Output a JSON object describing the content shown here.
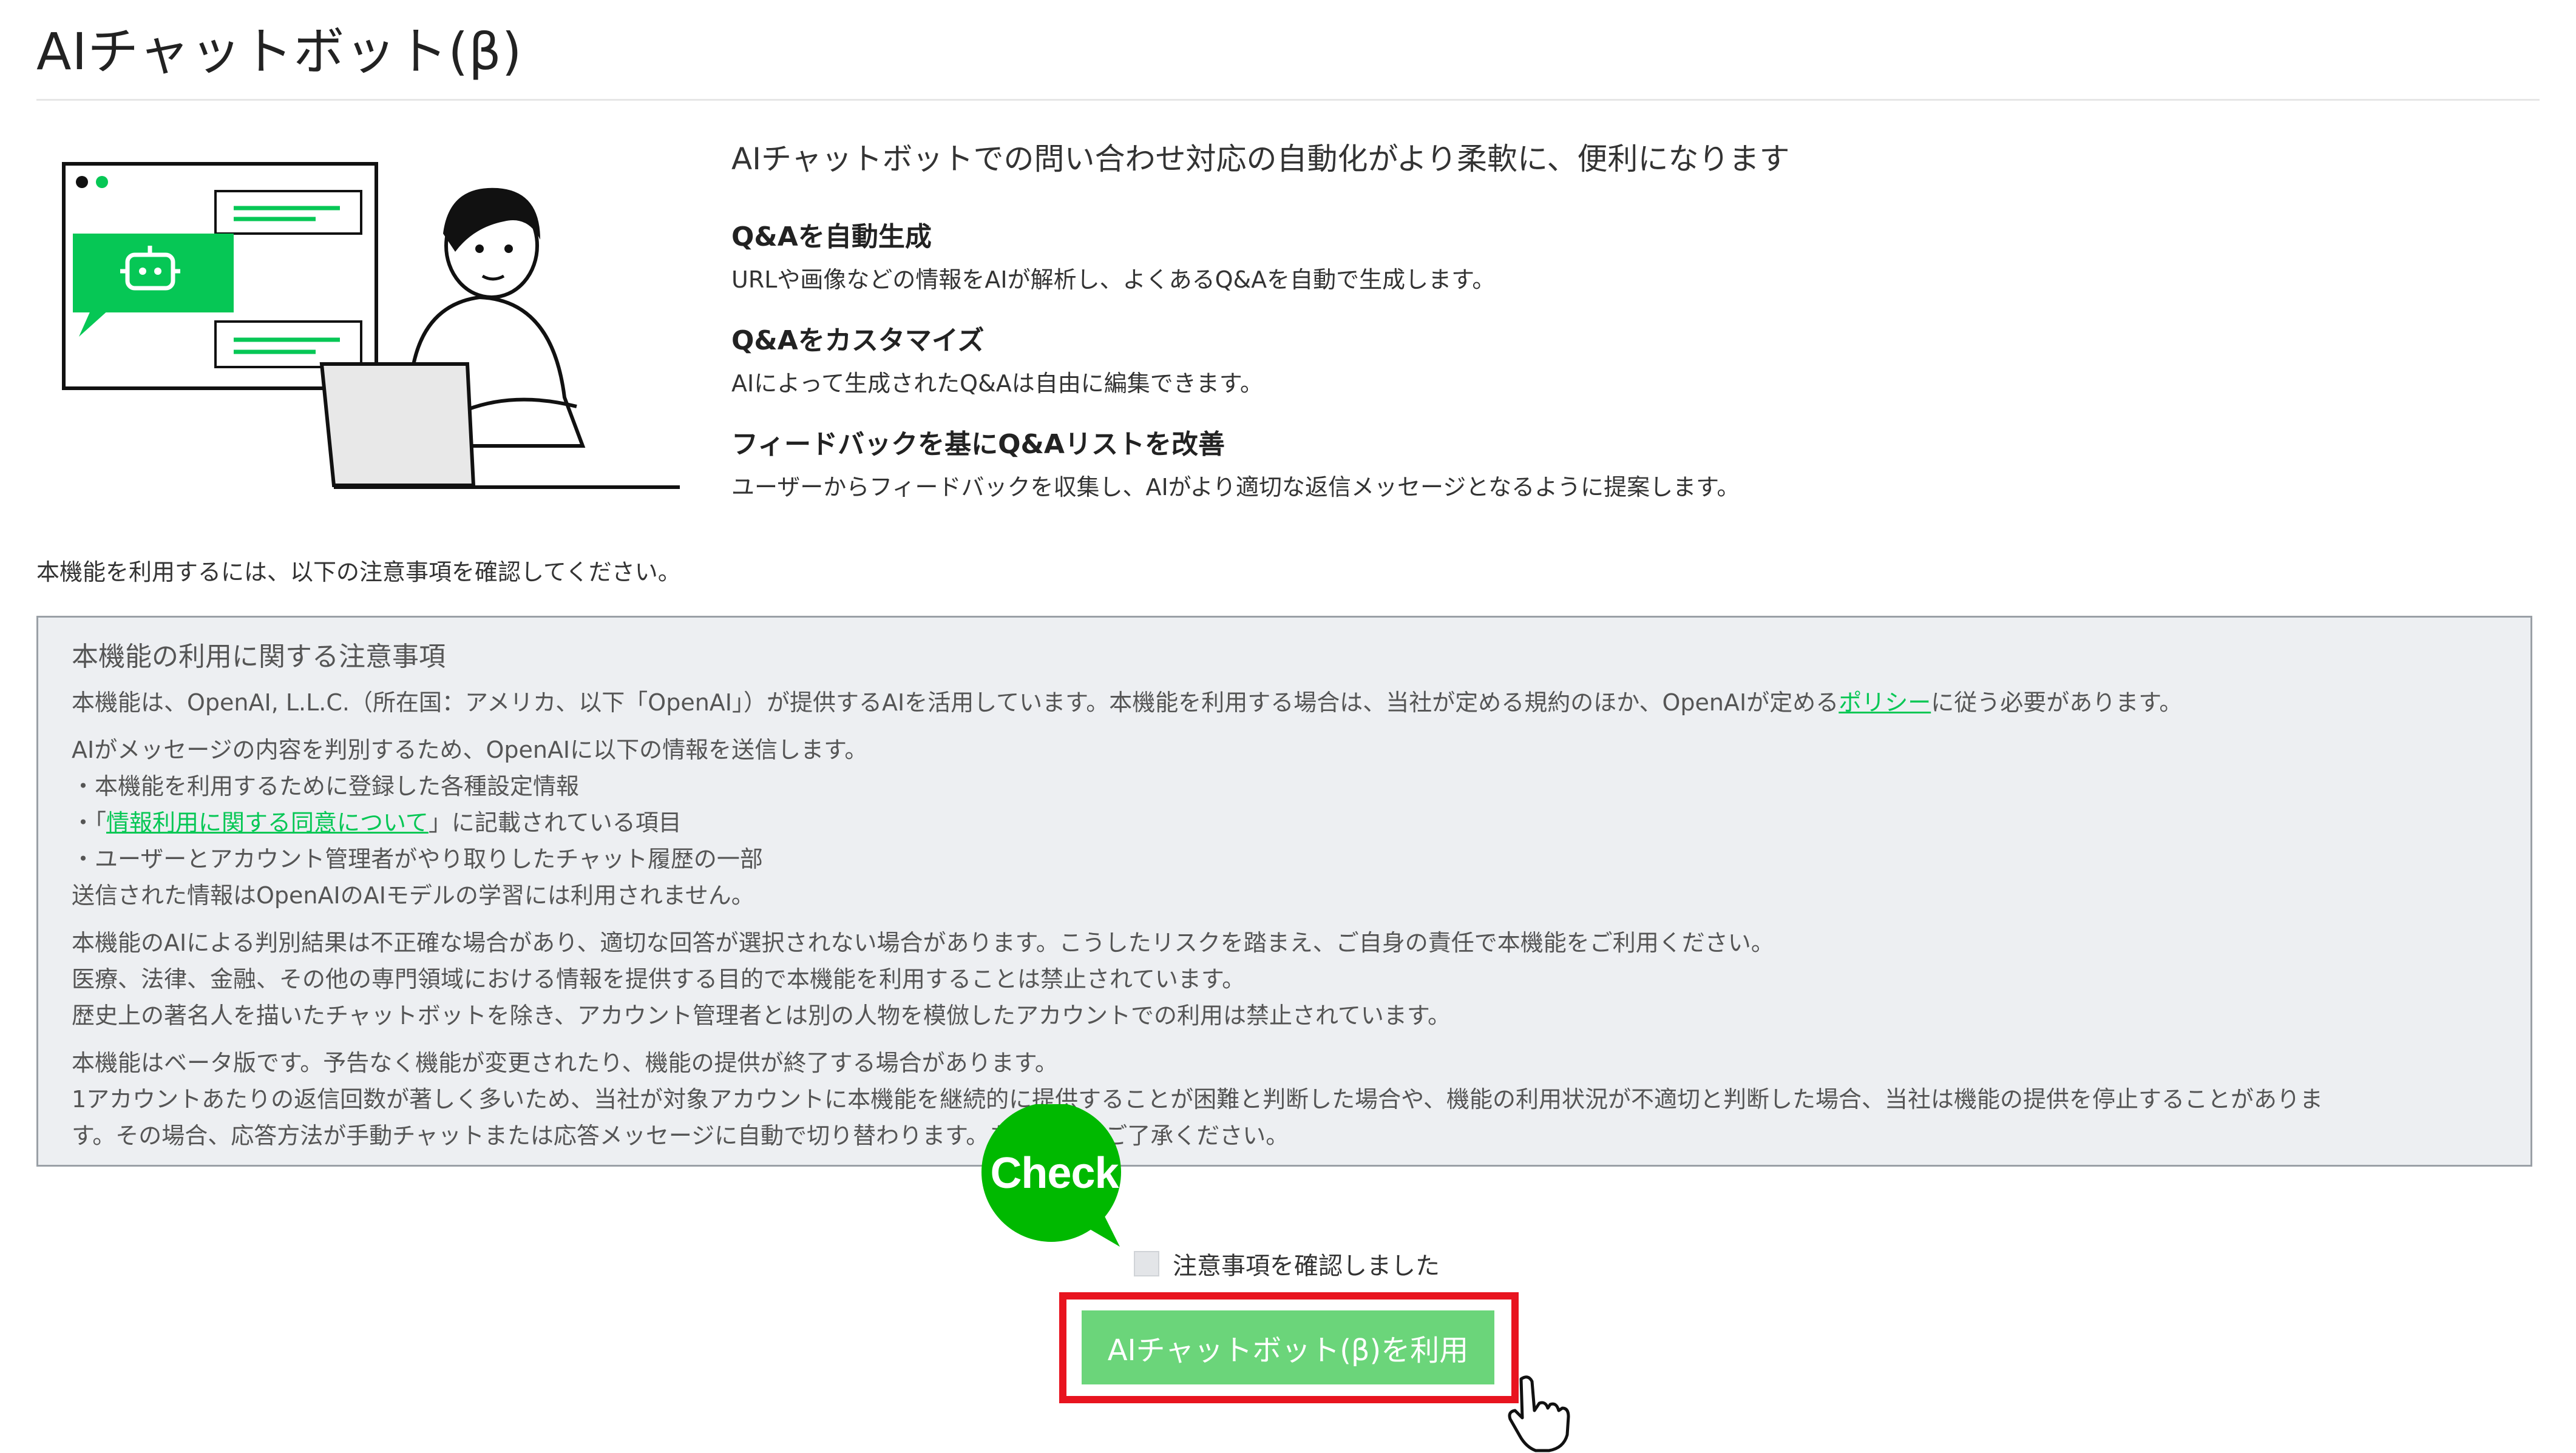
{
  "page": {
    "title": "AIチャットボット(β)"
  },
  "intro": {
    "headline": "AIチャットボットでの問い合わせ対応の自動化がより柔軟に、便利になります",
    "features": [
      {
        "title": "Q&Aを自動生成",
        "description": "URLや画像などの情報をAIが解析し、よくあるQ&Aを自動で生成します。"
      },
      {
        "title": "Q&Aをカスタマイズ",
        "description": "AIによって生成されたQ&Aは自由に編集できます。"
      },
      {
        "title": "フィードバックを基にQ&Aリストを改善",
        "description": "ユーザーからフィードバックを収集し、AIがより適切な返信メッセージとなるように提案します。"
      }
    ]
  },
  "confirm_prompt": "本機能を利用するには、以下の注意事項を確認してください。",
  "notice": {
    "title": "本機能の利用に関する注意事項",
    "para1": {
      "before": "本機能は、OpenAI, L.L.C.（所在国：アメリカ、以下「OpenAI」）が提供するAIを活用しています。本機能を利用する場合は、当社が定める規約のほか、OpenAIが定める",
      "link": "ポリシー",
      "after": "に従う必要があります。"
    },
    "para2": {
      "line1": "AIがメッセージの内容を判別するため、OpenAIに以下の情報を送信します。",
      "line2": "・本機能を利用するために登録した各種設定情報",
      "line3_prefix": "・「",
      "line3_link": "情報利用に関する同意について",
      "line3_suffix": "」に記載されている項目",
      "line4": "・ユーザーとアカウント管理者がやり取りしたチャット履歴の一部",
      "line5": "送信された情報はOpenAIのAIモデルの学習には利用されません。"
    },
    "para3": {
      "line1": "本機能のAIによる判別結果は不正確な場合があり、適切な回答が選択されない場合があります。こうしたリスクを踏まえ、ご自身の責任で本機能をご利用ください。",
      "line2": "医療、法律、金融、その他の専門領域における情報を提供する目的で本機能を利用することは禁止されています。",
      "line3": "歴史上の著名人を描いたチャットボットを除き、アカウント管理者とは別の人物を模倣したアカウントでの利用は禁止されています。"
    },
    "para4": {
      "line1": "本機能はベータ版です。予告なく機能が変更されたり、機能の提供が終了する場合があります。",
      "line2": "1アカウントあたりの返信回数が著しく多いため、当社が対象アカウントに本機能を継続的に提供することが困難と判断した場合や、機能の利用状況が不適切と判断した場合、当社は機能の提供を停止することがありま",
      "line3": "す。その場合、応答方法が手動チャットまたは応答メッセージに自動で切り替わります。あらかじめご了承ください。"
    }
  },
  "callout": {
    "label": "Check",
    "color": "#00b900"
  },
  "agreement": {
    "checkbox_label": "注意事項を確認しました",
    "checked": false
  },
  "action": {
    "button_label": "AIチャットボット(β)を利用",
    "button_color": "#6bd57a",
    "highlight_color": "#e8141f"
  },
  "colors": {
    "brand_green": "#06c755",
    "notice_bg": "#edeff2"
  }
}
